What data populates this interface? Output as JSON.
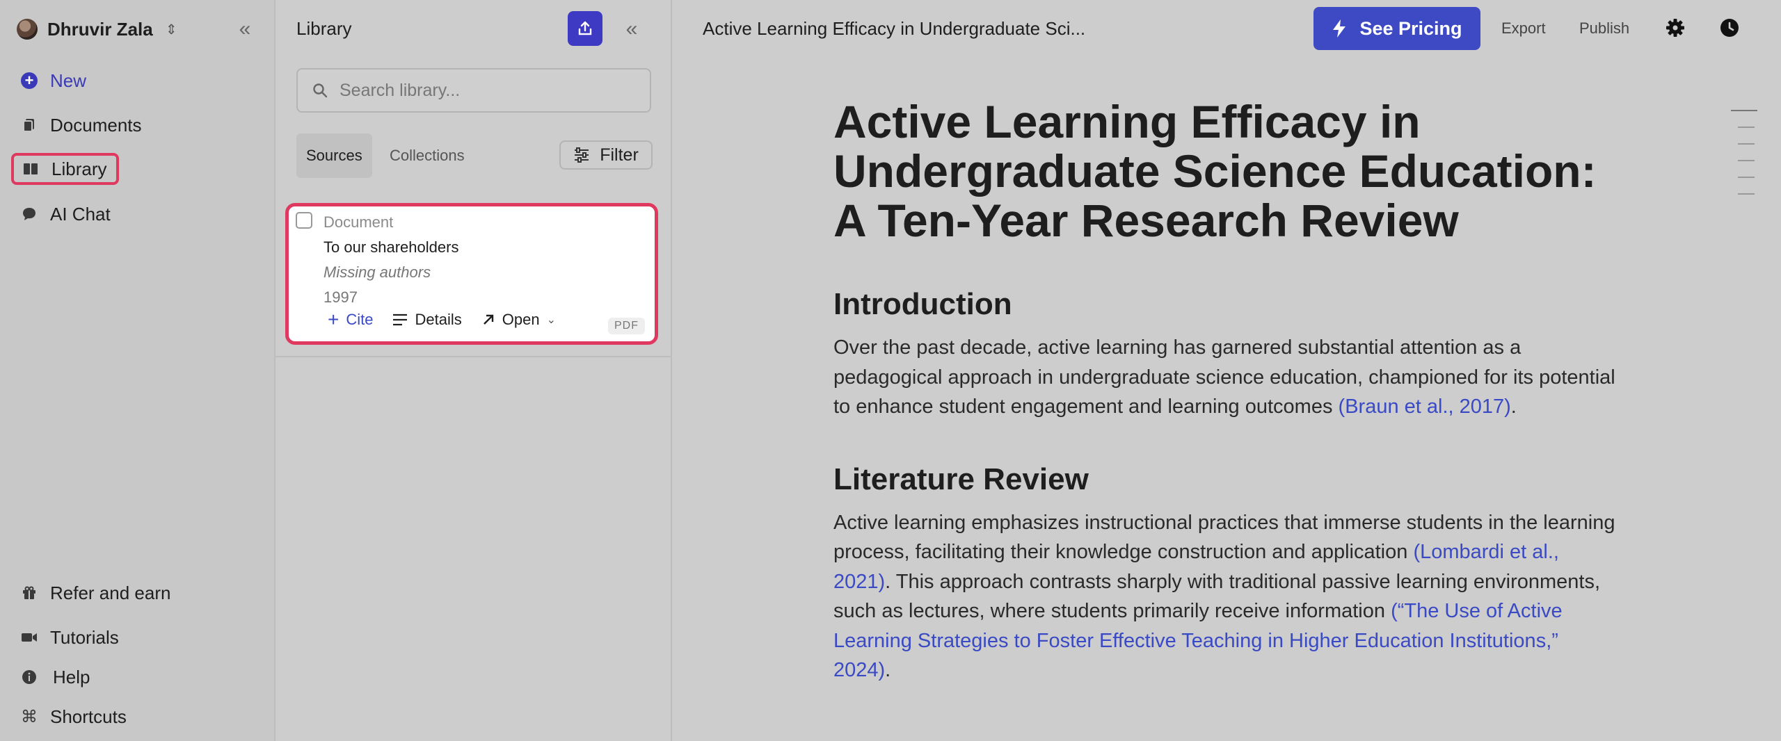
{
  "sidebar": {
    "user_name": "Dhruvir Zala",
    "nav": {
      "new": "New",
      "documents": "Documents",
      "library": "Library",
      "ai_chat": "AI Chat"
    },
    "bottom": {
      "refer": "Refer and earn",
      "tutorials": "Tutorials",
      "help": "Help",
      "shortcuts": "Shortcuts"
    }
  },
  "library": {
    "title": "Library",
    "search_placeholder": "Search library...",
    "tabs": {
      "sources": "Sources",
      "collections": "Collections"
    },
    "filter_label": "Filter",
    "card": {
      "type": "Document",
      "title": "To our shareholders",
      "authors": "Missing authors",
      "year": "1997",
      "cite": "Cite",
      "details": "Details",
      "open": "Open",
      "badge": "PDF"
    }
  },
  "topbar": {
    "doc_title": "Active Learning Efficacy in Undergraduate Sci...",
    "pricing": "See Pricing",
    "export": "Export",
    "publish": "Publish"
  },
  "document": {
    "title": "Active Learning Efficacy in Undergraduate Science Education: A Ten-Year Research Review",
    "sections": [
      {
        "heading": "Introduction",
        "text": "Over the past decade, active learning has garnered substantial attention as a pedagogical approach in undergraduate science education, championed for its potential to enhance student engagement and learning outcomes ",
        "cite1": "(Braun et al., 2017)",
        "tail": "."
      },
      {
        "heading": "Literature Review",
        "text1": "Active learning emphasizes instructional practices that immerse students in the learning process, facilitating their knowledge construction and application ",
        "cite1": "(Lombardi et al., 2021)",
        "text2": ". This approach contrasts sharply with traditional passive learning environments, such as lectures, where students primarily receive information ",
        "cite2": "(“The Use of Active Learning Strategies to Foster Effective Teaching in Higher Education Institutions,” 2024)",
        "tail": "."
      }
    ]
  },
  "colors": {
    "accent": "#3e3ac4",
    "link": "#3a4ac4",
    "highlight": "#e0395f"
  }
}
